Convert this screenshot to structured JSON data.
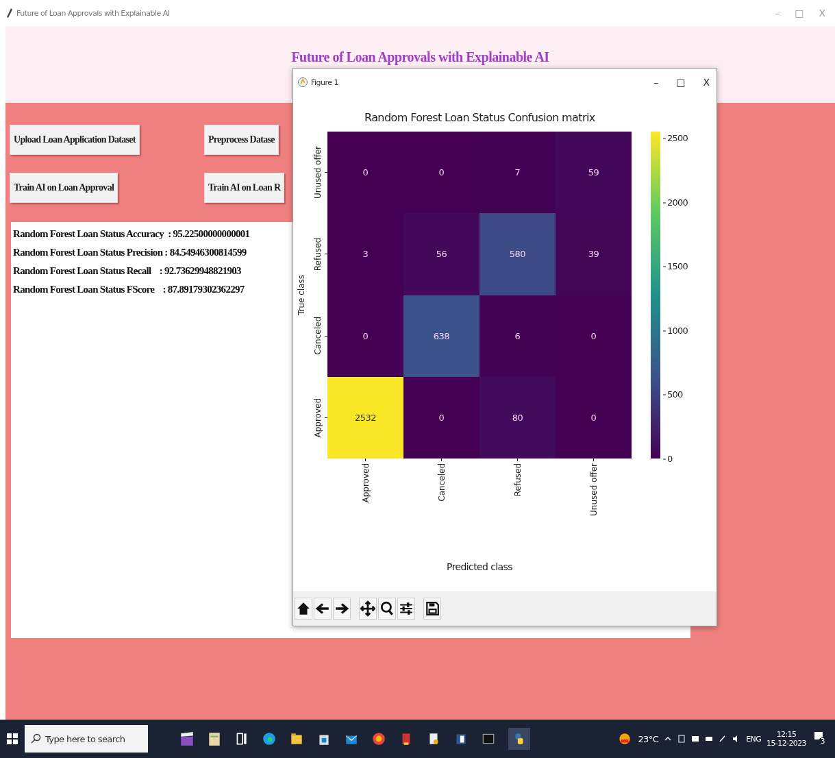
{
  "window": {
    "title": "Future of Loan Approvals with Explainable AI",
    "controls": [
      "–",
      "□",
      "X"
    ]
  },
  "header": {
    "title": "Future of Loan Approvals with Explainable AI"
  },
  "buttons": [
    {
      "label": "Upload Loan Application Dataset"
    },
    {
      "label": "Preprocess Datase"
    },
    {
      "label": "Train AI on Loan Approval"
    },
    {
      "label": "Train AI on Loan R"
    }
  ],
  "results": [
    "Random Forest Loan Status Accuracy  : 95.22500000000001",
    "Random Forest Loan Status Precision : 84.54946300814599",
    "Random Forest Loan Status Recall    : 92.73629948821903",
    "Random Forest Loan Status FScore    : 87.89179302362297"
  ],
  "figure": {
    "title": "Figure 1",
    "controls": [
      "–",
      "□",
      "X"
    ],
    "plot": {
      "title": "Random Forest Loan Status Confusion matrix",
      "ylabel": "True class",
      "xlabel": "Predicted class",
      "row_labels": [
        "Unused offer",
        "Refused",
        "Canceled",
        "Approved"
      ],
      "column_labels": [
        "Approved",
        "Canceled",
        "Refused",
        "Unused offer"
      ],
      "rows": [
        [
          "0",
          "0",
          "7",
          "59"
        ],
        [
          "3",
          "56",
          "580",
          "39"
        ],
        [
          "0",
          "638",
          "6",
          "0"
        ],
        [
          "2532",
          "0",
          "80",
          "0"
        ]
      ],
      "colorbar_ticks": [
        "2500",
        "2000",
        "1500",
        "1000",
        "500",
        "0"
      ]
    }
  },
  "taskbar": {
    "search_placeholder": "Type here to search",
    "temperature": "23°C",
    "language": "ENG",
    "time": "12:15",
    "date": "15-12-2023",
    "notifications": "3"
  }
}
